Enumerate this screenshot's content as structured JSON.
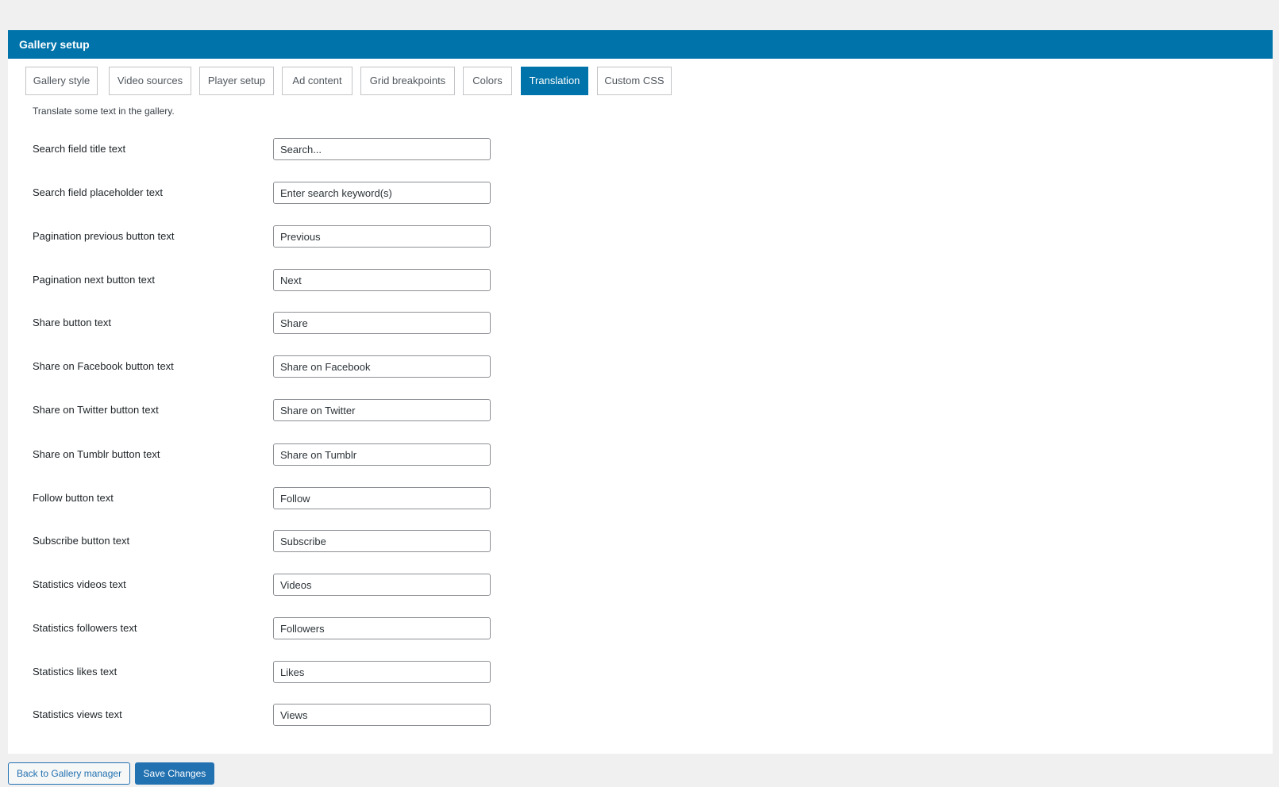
{
  "panel": {
    "title": "Gallery setup"
  },
  "tabs": [
    {
      "label": "Gallery style",
      "active": false
    },
    {
      "label": "Video sources",
      "active": false
    },
    {
      "label": "Player setup",
      "active": false
    },
    {
      "label": "Ad content",
      "active": false
    },
    {
      "label": "Grid breakpoints",
      "active": false
    },
    {
      "label": "Colors",
      "active": false
    },
    {
      "label": "Translation",
      "active": true
    },
    {
      "label": "Custom CSS",
      "active": false
    }
  ],
  "translation": {
    "description": "Translate some text in the gallery.",
    "fields": [
      {
        "label": "Search field title text",
        "value": "Search..."
      },
      {
        "label": "Search field placeholder text",
        "value": "Enter search keyword(s)"
      },
      {
        "label": "Pagination previous button text",
        "value": "Previous"
      },
      {
        "label": "Pagination next button text",
        "value": "Next"
      },
      {
        "label": "Share button text",
        "value": "Share"
      },
      {
        "label": "Share on Facebook button text",
        "value": "Share on Facebook"
      },
      {
        "label": "Share on Twitter button text",
        "value": "Share on Twitter"
      },
      {
        "label": "Share on Tumblr button text",
        "value": "Share on Tumblr"
      },
      {
        "label": "Follow button text",
        "value": "Follow"
      },
      {
        "label": "Subscribe button text",
        "value": "Subscribe"
      },
      {
        "label": "Statistics videos text",
        "value": "Videos"
      },
      {
        "label": "Statistics followers text",
        "value": "Followers"
      },
      {
        "label": "Statistics likes text",
        "value": "Likes"
      },
      {
        "label": "Statistics views text",
        "value": "Views"
      }
    ]
  },
  "footer": {
    "back_label": "Back to Gallery manager",
    "save_label": "Save Changes"
  },
  "colors": {
    "accent": "#0073aa",
    "button_primary": "#2271b1",
    "background": "#f0f0f1"
  }
}
